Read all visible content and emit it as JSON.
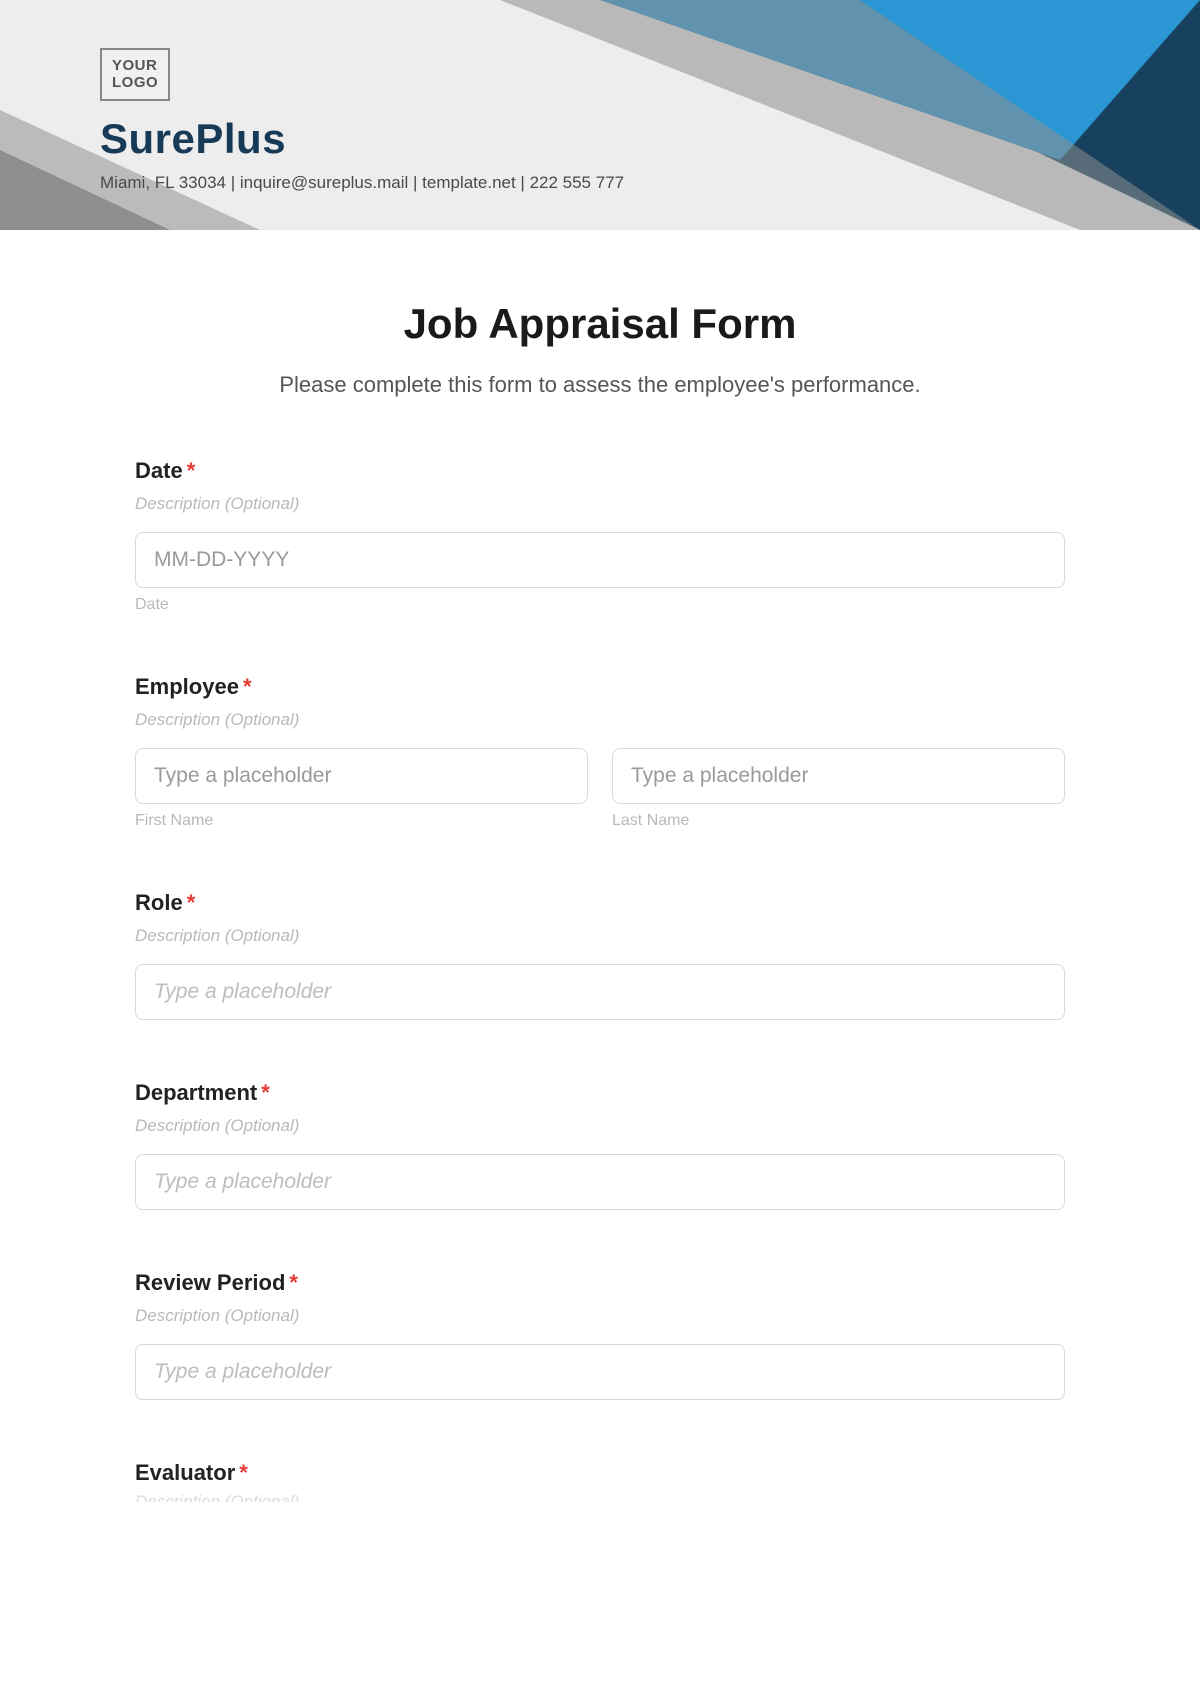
{
  "header": {
    "logo_line1": "YOUR",
    "logo_line2": "LOGO",
    "company": "SurePlus",
    "subline": "Miami, FL 33034 | inquire@sureplus.mail | template.net | 222 555 777"
  },
  "form": {
    "title": "Job Appraisal Form",
    "description": "Please complete this form to assess the employee's performance.",
    "required_mark": "*",
    "meta_optional": "Description (Optional)",
    "fields": {
      "date": {
        "label": "Date",
        "placeholder": "MM-DD-YYYY",
        "sublabel": "Date"
      },
      "employee": {
        "label": "Employee",
        "first_placeholder": "Type a placeholder",
        "last_placeholder": "Type a placeholder",
        "first_sub": "First Name",
        "last_sub": "Last Name"
      },
      "role": {
        "label": "Role",
        "placeholder": "Type a placeholder"
      },
      "department": {
        "label": "Department",
        "placeholder": "Type a placeholder"
      },
      "review_period": {
        "label": "Review Period",
        "placeholder": "Type a placeholder"
      },
      "evaluator": {
        "label": "Evaluator"
      }
    }
  }
}
